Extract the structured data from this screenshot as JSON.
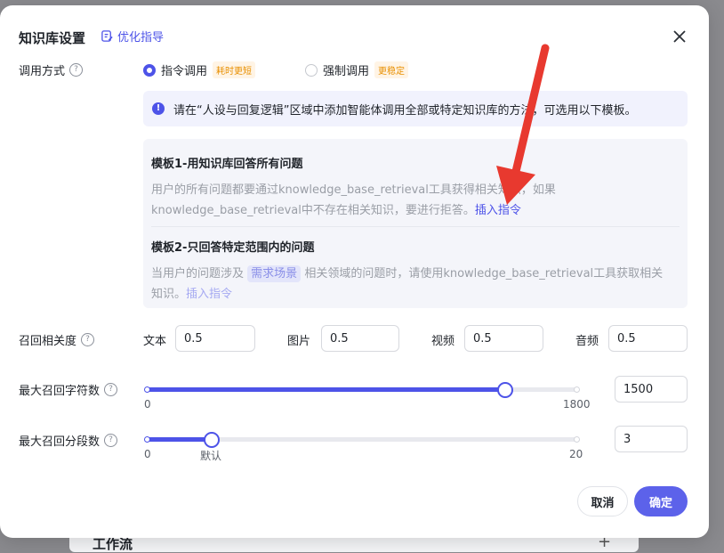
{
  "backdrop": {
    "card_title": "工作流",
    "plus": "+"
  },
  "dialog": {
    "title": "知识库设置",
    "guide_label": "优化指导",
    "close_icon": "close-icon"
  },
  "call_mode": {
    "label": "调用方式",
    "options": [
      {
        "label": "指令调用",
        "tag": "耗时更短",
        "checked": true
      },
      {
        "label": "强制调用",
        "tag": "更稳定",
        "checked": false
      }
    ],
    "info": "请在“人设与回复逻辑”区域中添加智能体调用全部或特定知识库的方法，可选用以下模板。"
  },
  "templates": [
    {
      "title": "模板1-用知识库回答所有问题",
      "body_line1": "用户的所有问题都要通过knowledge_base_retrieval工具获得相关知识，如果",
      "body_line2": "knowledge_base_retrieval中不存在相关知识，要进行拒答。",
      "action": "插入指令"
    },
    {
      "title": "模板2-只回答特定范围内的问题",
      "body_pre": "当用户的问题涉及",
      "chip": "需求场景",
      "body_post": "相关领域的问题时，请使用knowledge_base_retrieval工具获取相关",
      "body_line2": "知识。",
      "action": "插入指令"
    }
  ],
  "relevance": {
    "label": "召回相关度",
    "fields": [
      {
        "label": "文本",
        "value": "0.5"
      },
      {
        "label": "图片",
        "value": "0.5"
      },
      {
        "label": "视频",
        "value": "0.5"
      },
      {
        "label": "音频",
        "value": "0.5"
      }
    ]
  },
  "max_chars": {
    "label": "最大召回字符数",
    "min": "0",
    "max": "1800",
    "value": "1500",
    "level": 1500
  },
  "max_segments": {
    "label": "最大召回分段数",
    "min": "0",
    "max": "20",
    "value": "3",
    "level": 3,
    "default_label": "默认"
  },
  "footer": {
    "cancel": "取消",
    "confirm": "确定"
  },
  "colors": {
    "accent": "#4d53e8",
    "arrow": "#e8392f",
    "tag_text": "#e88f00"
  }
}
